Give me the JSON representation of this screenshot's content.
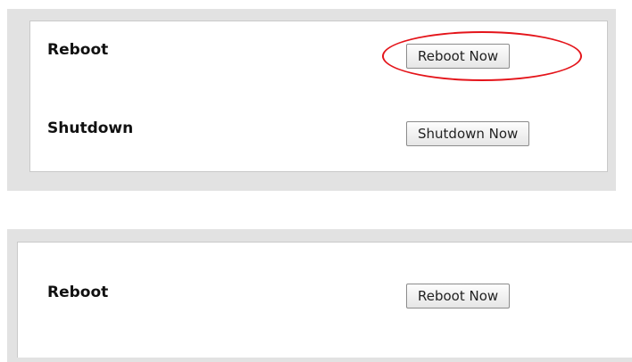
{
  "top_panel": {
    "reboot_label": "Reboot",
    "reboot_button": "Reboot Now",
    "shutdown_label": "Shutdown",
    "shutdown_button": "Shutdown Now",
    "highlight_color": "#e4141a"
  },
  "bottom_panel": {
    "reboot_label": "Reboot",
    "reboot_button": "Reboot Now"
  }
}
